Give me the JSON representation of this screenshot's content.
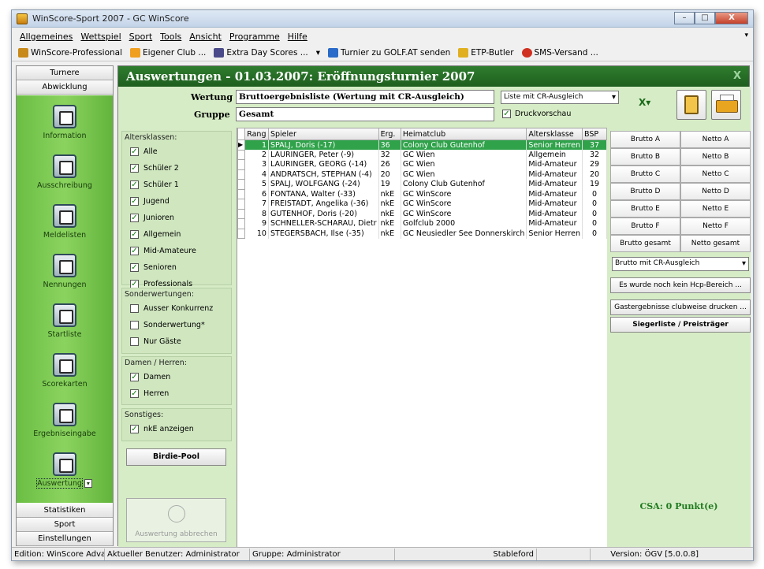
{
  "window": {
    "title": "WinScore-Sport 2007 - GC WinScore",
    "btn_min": "–",
    "btn_max": "□",
    "btn_close": "X"
  },
  "menu": {
    "items": [
      "Allgemeines",
      "Wettspiel",
      "Sport",
      "Tools",
      "Ansicht",
      "Programme",
      "Hilfe"
    ]
  },
  "toolbar": {
    "items": [
      "WinScore-Professional",
      "Eigener Club ...",
      "Extra Day Scores ...",
      "Turnier zu GOLF.AT senden",
      "ETP-Butler",
      "SMS-Versand ..."
    ]
  },
  "nav": {
    "top_tabs": [
      "Turnere",
      "Abwicklung"
    ],
    "items": [
      "Information",
      "Ausschreibung",
      "Meldelisten",
      "Nennungen",
      "Startliste",
      "Scorekarten",
      "Ergebniseingabe",
      "Auswertung"
    ],
    "bottom_tabs": [
      "Statistiken",
      "Sport",
      "Einstellungen"
    ]
  },
  "header": {
    "title": "Auswertungen - 01.03.2007: Eröffnungsturnier 2007",
    "close": "X"
  },
  "form": {
    "wertung_label": "Wertung",
    "wertung_value": "Bruttoergebnisliste (Wertung mit CR-Ausgleich)",
    "gruppe_label": "Gruppe",
    "gruppe_value": "Gesamt",
    "list_dropdown": "Liste mit CR-Ausgleich",
    "druckvorschau": "Druckvorschau"
  },
  "filters": {
    "altersklassen_title": "Altersklassen:",
    "altersklassen": [
      "Alle",
      "Schüler 2",
      "Schüler 1",
      "Jugend",
      "Junioren",
      "Allgemein",
      "Mid-Amateure",
      "Senioren",
      "Professionals"
    ],
    "sonder_title": "Sonderwertungen:",
    "sonder": [
      "Ausser Konkurrenz",
      "Sonderwertung*",
      "Nur Gäste"
    ],
    "damen_title": "Damen / Herren:",
    "damen": [
      "Damen",
      "Herren"
    ],
    "sonst_title": "Sonstiges:",
    "sonst": [
      "nkE anzeigen"
    ],
    "birdie_btn": "Birdie-Pool",
    "abort_btn": "Auswertung abbrechen"
  },
  "grid": {
    "headers": [
      "Rang",
      "Spieler",
      "Erg.",
      "Heimatclub",
      "Altersklasse",
      "BSP"
    ],
    "rows": [
      [
        "1",
        "SPALJ, Doris (-17)",
        "36",
        "Colony Club Gutenhof",
        "Senior Herren",
        "37"
      ],
      [
        "2",
        "LAURINGER, Peter (-9)",
        "32",
        "GC Wien",
        "Allgemein",
        "32"
      ],
      [
        "3",
        "LAURINGER, GEORG (-14)",
        "26",
        "GC Wien",
        "Mid-Amateur",
        "29"
      ],
      [
        "4",
        "ANDRATSCH, STEPHAN (-4)",
        "20",
        "GC Wien",
        "Mid-Amateur",
        "20"
      ],
      [
        "5",
        "SPALJ, WOLFGANG (-24)",
        "19",
        "Colony Club Gutenhof",
        "Mid-Amateur",
        "19"
      ],
      [
        "6",
        "FONTANA, Walter (-33)",
        "nkE",
        "GC WinScore",
        "Mid-Amateur",
        "0"
      ],
      [
        "7",
        "FREISTADT, Angelika (-36)",
        "nkE",
        "GC WinScore",
        "Mid-Amateur",
        "0"
      ],
      [
        "8",
        "GUTENHOF, Doris (-20)",
        "nkE",
        "GC WinScore",
        "Mid-Amateur",
        "0"
      ],
      [
        "9",
        "SCHNELLER-SCHARAU, Dietr",
        "nkE",
        "Golfclub 2000",
        "Mid-Amateur",
        "0"
      ],
      [
        "10",
        "STEGERSBACH, Ilse (-35)",
        "nkE",
        "GC Neusiedler See Donnerskirch",
        "Senior Herren",
        "0"
      ]
    ]
  },
  "right": {
    "brutto": [
      "Brutto A",
      "Brutto B",
      "Brutto C",
      "Brutto D",
      "Brutto E",
      "Brutto F",
      "Brutto gesamt"
    ],
    "netto": [
      "Netto A",
      "Netto B",
      "Netto C",
      "Netto D",
      "Netto E",
      "Netto F",
      "Netto gesamt"
    ],
    "dropdown": "Brutto mit CR-Ausgleich",
    "hcp_btn": "Es wurde noch kein Hcp-Bereich ...",
    "gast_btn": "Gastergebnisse clubweise drucken ...",
    "sieger_btn": "Siegerliste / Preisträger",
    "csa": "CSA: 0 Punkt(e)"
  },
  "status": {
    "edition": "Edition: WinScore Advanc",
    "user": "Aktueller Benutzer: Administrator",
    "group": "Gruppe: Administrator",
    "mode": "Stableford",
    "version": "Version: ÖGV [5.0.0.8]"
  }
}
